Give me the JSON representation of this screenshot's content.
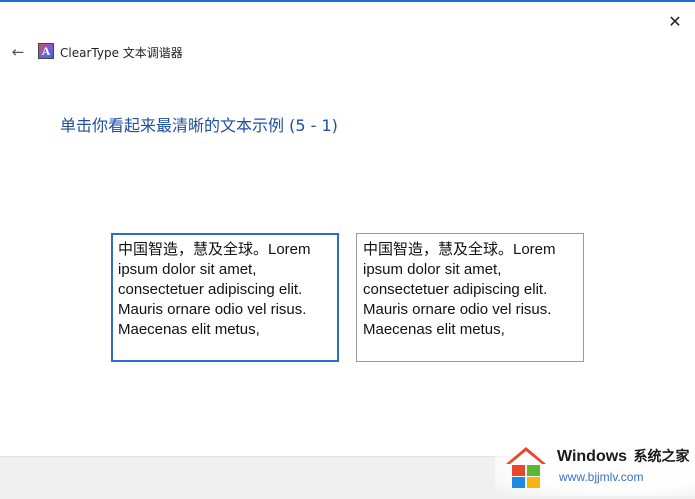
{
  "window": {
    "close_glyph": "✕",
    "back_glyph": "←"
  },
  "app": {
    "icon_letter": "A",
    "title": "ClearType 文本调谐器"
  },
  "instruction": "单击你看起来最清晰的文本示例 (5 - 1)",
  "samples": [
    {
      "text": "中国智造，慧及全球。Lorem ipsum dolor sit amet, consectetuer adipiscing elit. Mauris ornare odio vel risus. Maecenas elit metus,",
      "selected": true
    },
    {
      "text": "中国智造，慧及全球。Lorem ipsum dolor sit amet, consectetuer adipiscing elit. Mauris ornare odio vel risus. Maecenas elit metus,",
      "selected": false
    }
  ],
  "watermark": {
    "brand": "Windows",
    "brand_cn": "系统之家",
    "url": "www.bjjmlv.com",
    "colors": {
      "red": "#e8472a",
      "green": "#5cb82e",
      "blue": "#1e88e5",
      "yellow": "#f6b40e"
    }
  }
}
